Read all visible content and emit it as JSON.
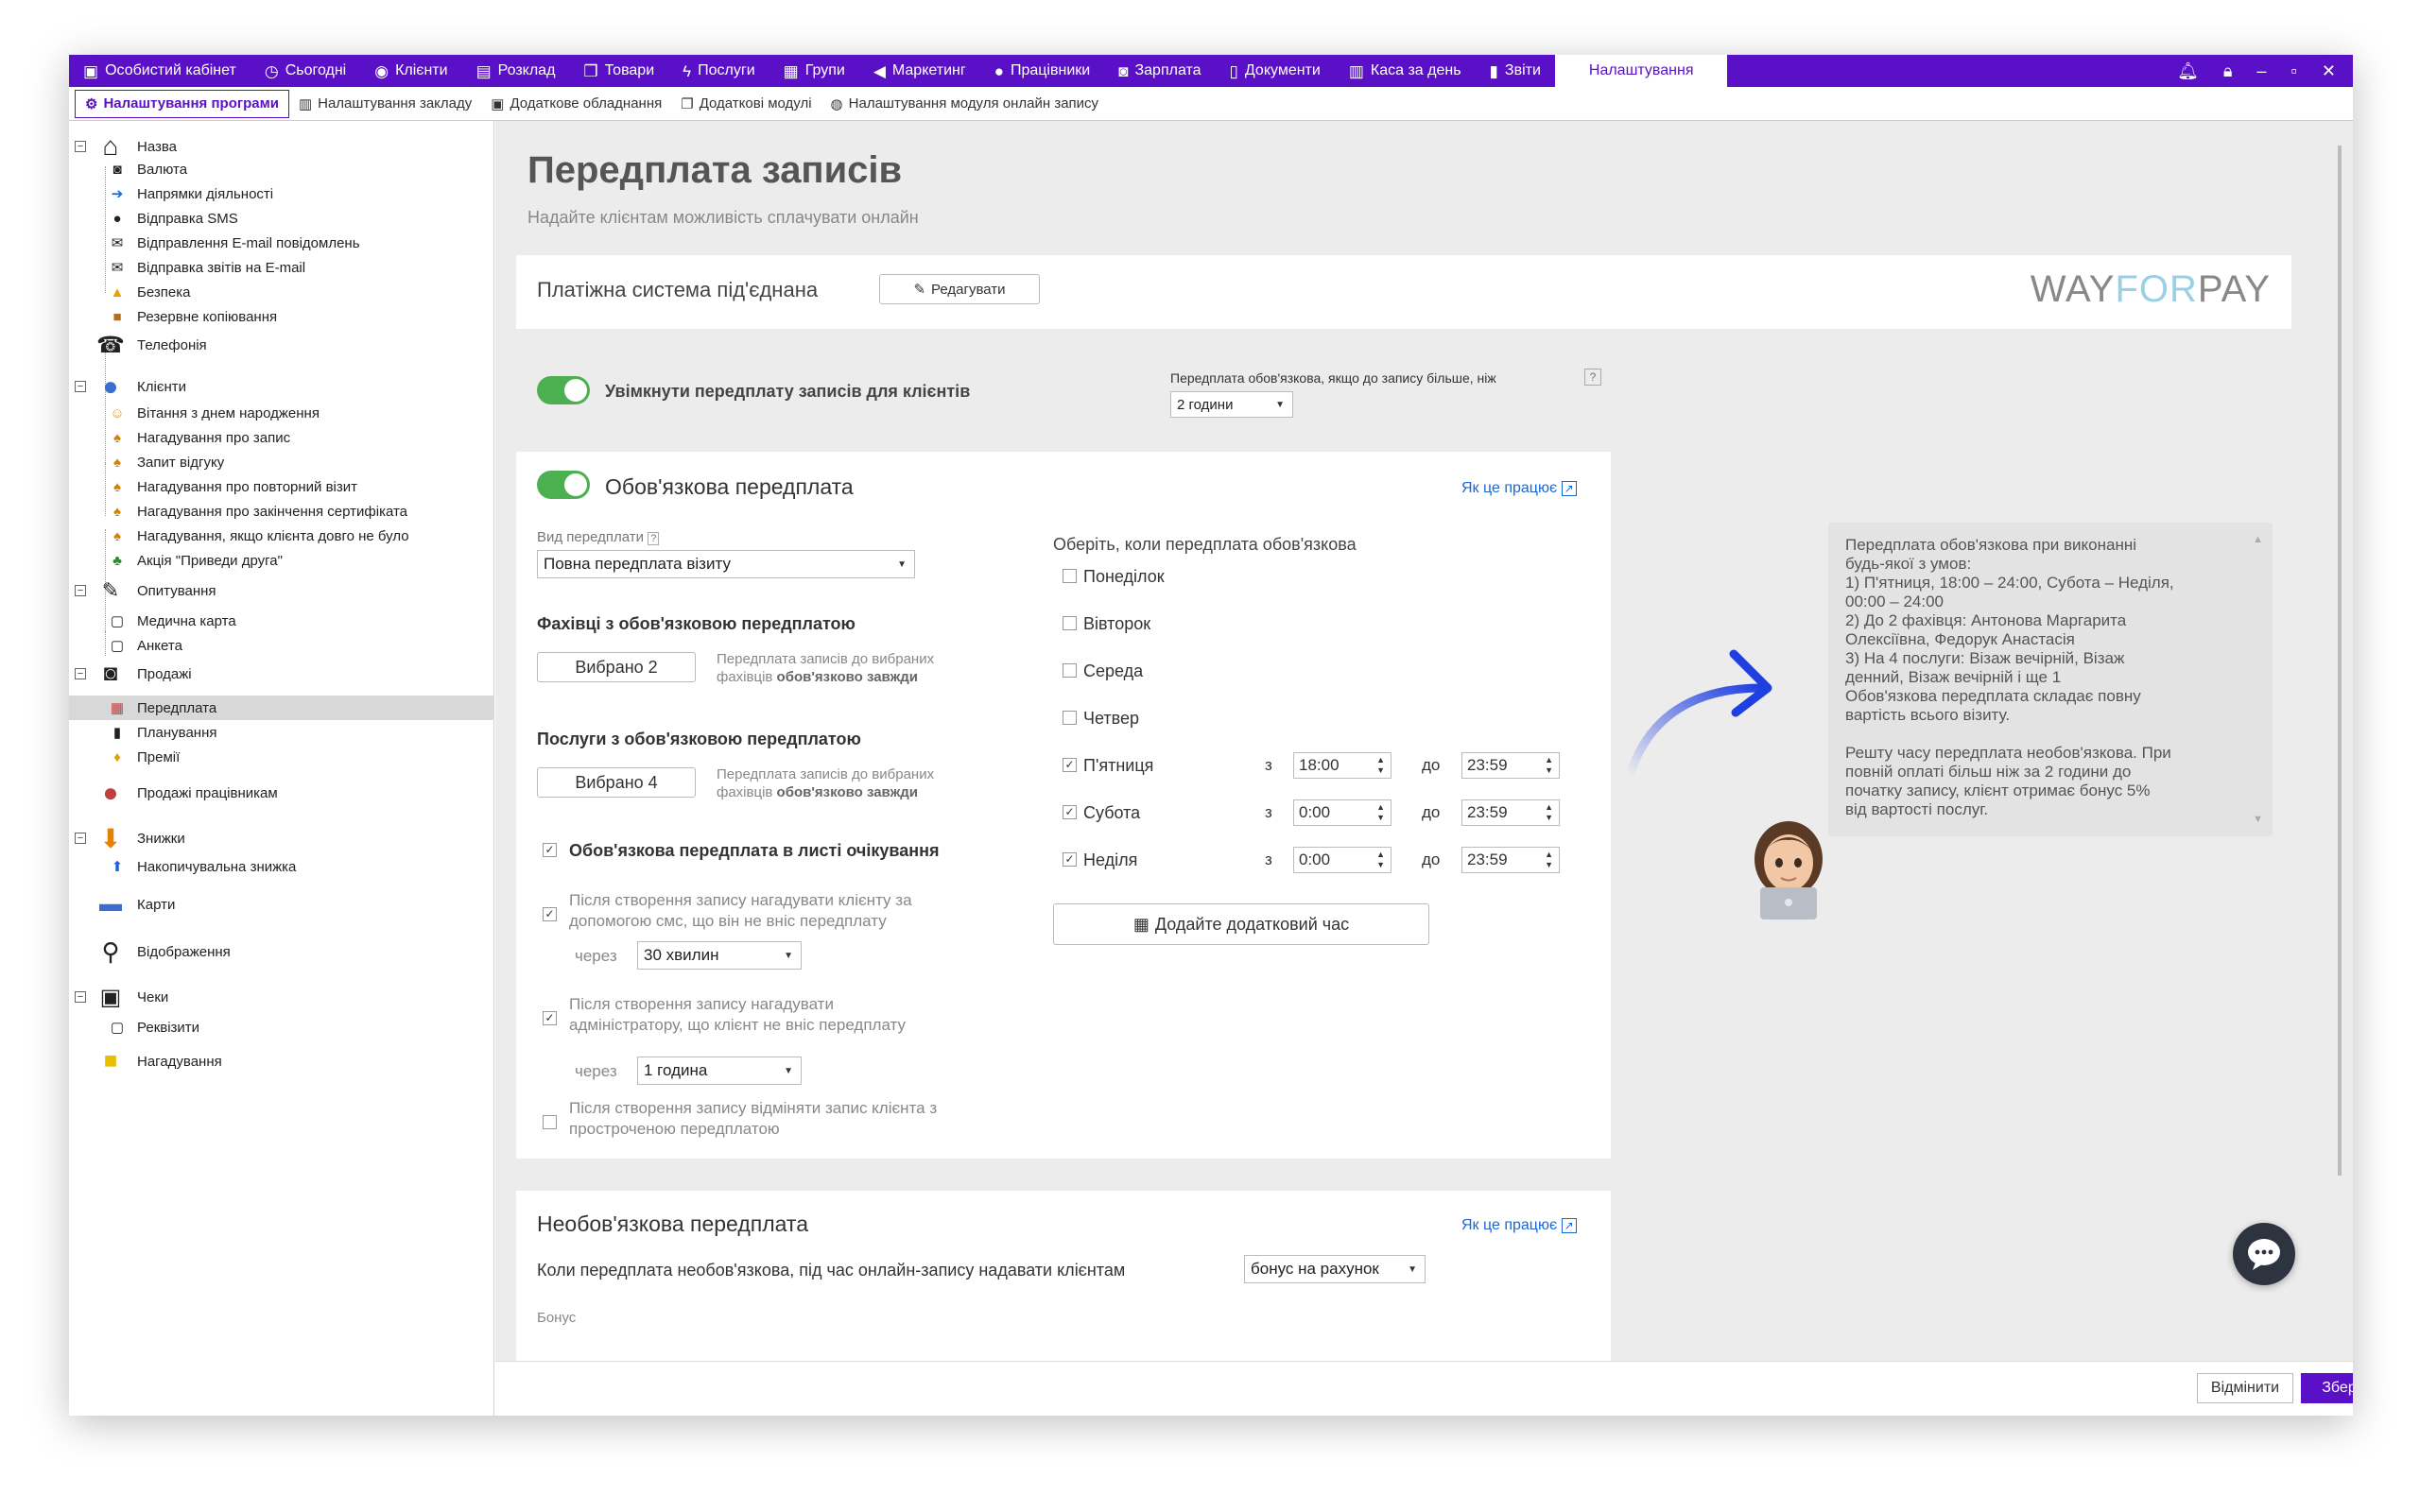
{
  "topbar": {
    "tabs": [
      {
        "label": "Особистий кабінет",
        "icon": "wallet-icon"
      },
      {
        "label": "Сьогодні",
        "icon": "clock-icon"
      },
      {
        "label": "Клієнти",
        "icon": "user-circle-icon"
      },
      {
        "label": "Розклад",
        "icon": "calendar-icon"
      },
      {
        "label": "Товари",
        "icon": "box-icon"
      },
      {
        "label": "Послуги",
        "icon": "lightning-icon"
      },
      {
        "label": "Групи",
        "icon": "group-icon"
      },
      {
        "label": "Маркетинг",
        "icon": "megaphone-icon"
      },
      {
        "label": "Працівники",
        "icon": "person-icon"
      },
      {
        "label": "Зарплата",
        "icon": "money-icon"
      },
      {
        "label": "Документи",
        "icon": "document-icon"
      },
      {
        "label": "Каса за день",
        "icon": "calculator-icon"
      },
      {
        "label": "Звіти",
        "icon": "bar-chart-icon"
      }
    ],
    "active_tab": "Налаштування"
  },
  "subtabs": [
    {
      "label": "Налаштування програми",
      "icon": "gear-icon"
    },
    {
      "label": "Налаштування закладу",
      "icon": "building-icon"
    },
    {
      "label": "Додаткове обладнання",
      "icon": "printer-icon"
    },
    {
      "label": "Додаткові модулі",
      "icon": "window-icon"
    },
    {
      "label": "Налаштування модуля онлайн запису",
      "icon": "globe-icon"
    }
  ],
  "tree": {
    "nazva": "Назва",
    "valuta": "Валюта",
    "napryamky": "Напрямки діяльності",
    "sms": "Відправка SMS",
    "email_notif": "Відправлення E-mail повідомлень",
    "email_reports": "Відправка звітів на E-mail",
    "bezpeka": "Безпека",
    "backup": "Резервне копіювання",
    "telefonia": "Телефонія",
    "klienty": "Клієнти",
    "birthday": "Вітання з днем народження",
    "remind_visit": "Нагадування про запис",
    "feedback": "Запит відгуку",
    "repeat_visit": "Нагадування про повторний візит",
    "cert_end": "Нагадування про закінчення сертифіката",
    "long_absent": "Нагадування, якщо клієнта довго не було",
    "bring_friend": "Акція \"Приведи друга\"",
    "opytuvannya": "Опитування",
    "med_card": "Медична карта",
    "anketa": "Анкета",
    "prodazhi": "Продажі",
    "peredplata": "Передплата",
    "planuvannya": "Планування",
    "premii": "Премії",
    "staff_sales": "Продажі працівникам",
    "znyzhky": "Знижки",
    "cumulative": "Накопичувальна знижка",
    "karty": "Карти",
    "vidobrazhennya": "Відображення",
    "cheky": "Чеки",
    "rekvizyty": "Реквізити",
    "nahaduvannya": "Нагадування"
  },
  "page": {
    "title": "Передплата записів",
    "subtitle": "Надайте клієнтам можливість сплачувати онлайн"
  },
  "payment": {
    "status": "Платіжна система під'єднана",
    "edit_button": "Редагувати",
    "brand_left": "WAY",
    "brand_mid": "FOR",
    "brand_right": "PAY"
  },
  "enable": {
    "label": "Увімкнути передплату записів для клієнтів",
    "threshold_label": "Передплата обов'язкова, якщо до запису більше, ніж",
    "threshold_value": "2 години",
    "help": "?"
  },
  "mandatory": {
    "title": "Обов'язкова передплата",
    "how_link": "Як це працює",
    "type_label": "Вид передплати",
    "type_value": "Повна передплата візиту",
    "specialists_title": "Фахівці з обов'язковою передплатою",
    "specialists_button": "Вибрано 2",
    "specialists_hint_1": "Передплата записів до вибраних",
    "specialists_hint_2a": "фахівців ",
    "specialists_hint_2b": "обов'язково завжди",
    "services_title": "Послуги з обов'язковою передплатою",
    "services_button": "Вибрано 4",
    "services_hint_1": "Передплата записів до вибраних",
    "services_hint_2a": "фахівців ",
    "services_hint_2b": "обов'язково завжди",
    "waitlist_label": "Обов'язкова передплата в листі очікування",
    "sms_remind_1": "Після створення запису нагадувати клієнту за",
    "sms_remind_2": "допомогою смс, що він не вніс передплату",
    "via": "через",
    "sms_delay": "30 хвилин",
    "admin_remind_1": "Після створення запису нагадувати",
    "admin_remind_2": "адміністратору, що клієнт не вніс передплату",
    "admin_delay": "1 година",
    "cancel_1": "Після створення запису відміняти запис клієнта з",
    "cancel_2": "простроченою передплатою",
    "days_title": "Оберіть, коли передплата обов'язкова",
    "days": [
      {
        "label": "Понеділок",
        "checked": false
      },
      {
        "label": "Вівторок",
        "checked": false
      },
      {
        "label": "Середа",
        "checked": false
      },
      {
        "label": "Четвер",
        "checked": false
      },
      {
        "label": "П'ятниця",
        "checked": true,
        "from": "18:00",
        "to": "23:59"
      },
      {
        "label": "Субота",
        "checked": true,
        "from": "0:00",
        "to": "23:59"
      },
      {
        "label": "Неділя",
        "checked": true,
        "from": "0:00",
        "to": "23:59"
      }
    ],
    "from_label": "з",
    "to_label": "до",
    "add_time_button": "Додайте додатковий час"
  },
  "tooltip": {
    "l1": "Передплата обов'язкова при виконанні",
    "l2": "будь-якої з умов:",
    "l3": "1) П'ятниця, 18:00 – 24:00, Субота – Неділя,",
    "l4": "00:00 – 24:00",
    "l5": "2) До 2 фахівця:  Антонова Маргарита",
    "l6": "Олексіївна, Федорук Анастасія",
    "l7": "3) На 4 послуги: Візаж вечірній, Візаж",
    "l8": "денний, Візаж вечірній і ще 1",
    "l9": "Обов'язкова передплата складає повну",
    "l10": "вартість всього візиту.",
    "l11": "Решту часу передплата необов'язкова. При",
    "l12": "повній оплаті більш ніж за 2 години до",
    "l13": "початку запису, клієнт отримає бонус 5%",
    "l14": "від вартості послуг."
  },
  "optional": {
    "title": "Необов'язкова передплата",
    "how_link": "Як це працює",
    "label": "Коли передплата необов'язкова, під час онлайн-запису надавати клієнтам",
    "value": "бонус на рахунок",
    "bonus_label": "Бонус"
  },
  "footer": {
    "cancel": "Відмінити",
    "save": "Зберегти"
  },
  "colors": {
    "accent": "#5a10c6",
    "toggle_on": "#4caf50",
    "link": "#1a66d6",
    "arrow": "#1f3fe0"
  }
}
